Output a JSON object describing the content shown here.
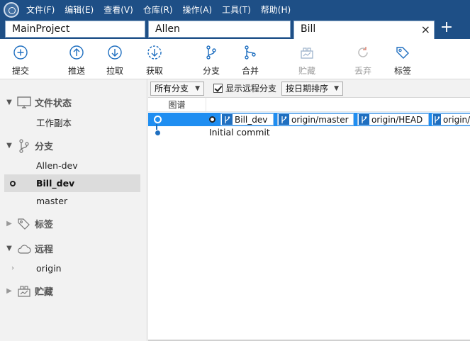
{
  "menu": [
    "文件(F)",
    "编辑(E)",
    "查看(V)",
    "仓库(R)",
    "操作(A)",
    "工具(T)",
    "帮助(H)"
  ],
  "tabs": [
    {
      "label": "MainProject"
    },
    {
      "label": "Allen"
    },
    {
      "label": "Bill",
      "close": "×"
    }
  ],
  "tab_add": "+",
  "toolbar": {
    "commit": "提交",
    "push": "推送",
    "pull": "拉取",
    "fetch": "获取",
    "branch": "分支",
    "merge": "合并",
    "stash": "贮藏",
    "discard": "丢弃",
    "tag": "标签"
  },
  "sidebar": {
    "file_status": "文件状态",
    "working_copy": "工作副本",
    "branches": "分支",
    "branch_items": [
      "Allen-dev",
      "Bill_dev",
      "master"
    ],
    "tags": "标签",
    "remotes": "远程",
    "remote_items": [
      "origin"
    ],
    "stashes": "贮藏"
  },
  "filter": {
    "branches": "所有分支",
    "show_remote": "显示远程分支",
    "sort": "按日期排序"
  },
  "columns": {
    "graph": "图谱"
  },
  "commits": [
    {
      "refs": [
        "Bill_dev",
        "origin/master",
        "origin/HEAD",
        "origin/Allen-dev"
      ]
    },
    {
      "message": "Initial commit"
    }
  ],
  "colors": {
    "menubar": "#1e4f86",
    "accent": "#1f8ef1",
    "branch_icon": "#1f6fc0"
  }
}
